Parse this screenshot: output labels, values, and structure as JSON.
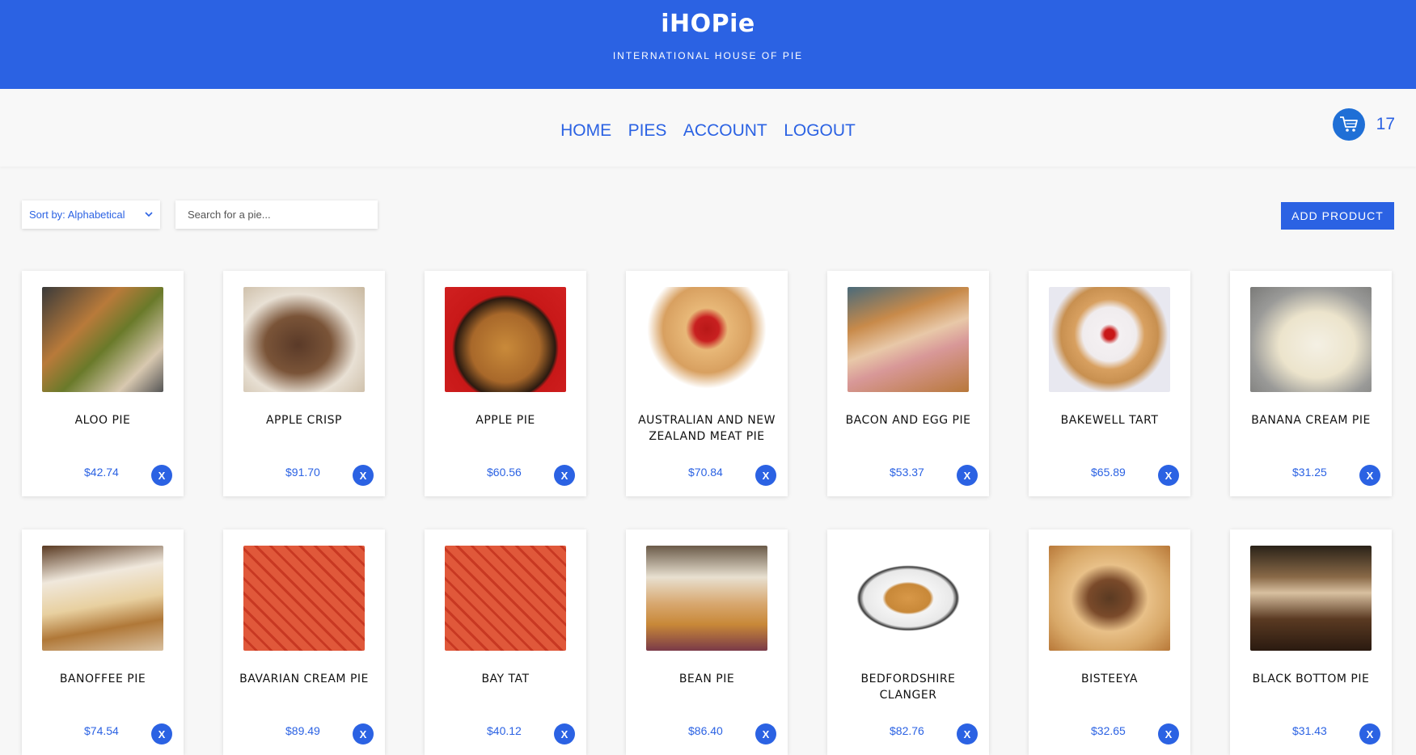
{
  "header": {
    "brand": "iHOPie",
    "tagline": "INTERNATIONAL HOUSE OF PIE"
  },
  "nav": {
    "links": [
      "HOME",
      "PIES",
      "ACCOUNT",
      "LOGOUT"
    ]
  },
  "cart": {
    "icon": "cart-icon",
    "count": "17"
  },
  "toolbar": {
    "sort_label": "Sort by: Alphabetical",
    "search_placeholder": "Search for a pie...",
    "add_product_label": "ADD PRODUCT"
  },
  "products": [
    {
      "name": "ALOO PIE",
      "price": "$42.74",
      "remove_label": "X"
    },
    {
      "name": "APPLE CRISP",
      "price": "$91.70",
      "remove_label": "X"
    },
    {
      "name": "APPLE PIE",
      "price": "$60.56",
      "remove_label": "X"
    },
    {
      "name": "AUSTRALIAN AND NEW ZEALAND MEAT PIE",
      "price": "$70.84",
      "remove_label": "X"
    },
    {
      "name": "BACON AND EGG PIE",
      "price": "$53.37",
      "remove_label": "X"
    },
    {
      "name": "BAKEWELL TART",
      "price": "$65.89",
      "remove_label": "X"
    },
    {
      "name": "BANANA CREAM PIE",
      "price": "$31.25",
      "remove_label": "X"
    },
    {
      "name": "BANOFFEE PIE",
      "price": "$74.54",
      "remove_label": "X"
    },
    {
      "name": "BAVARIAN CREAM PIE",
      "price": "$89.49",
      "remove_label": "X"
    },
    {
      "name": "BAY TAT",
      "price": "$40.12",
      "remove_label": "X"
    },
    {
      "name": "BEAN PIE",
      "price": "$86.40",
      "remove_label": "X"
    },
    {
      "name": "BEDFORDSHIRE CLANGER",
      "price": "$82.76",
      "remove_label": "X"
    },
    {
      "name": "BISTEEYA",
      "price": "$32.65",
      "remove_label": "X"
    },
    {
      "name": "BLACK BOTTOM PIE",
      "price": "$31.43",
      "remove_label": "X"
    }
  ],
  "colors": {
    "brand": "#2b62e3",
    "background": "#f7f7f7"
  }
}
